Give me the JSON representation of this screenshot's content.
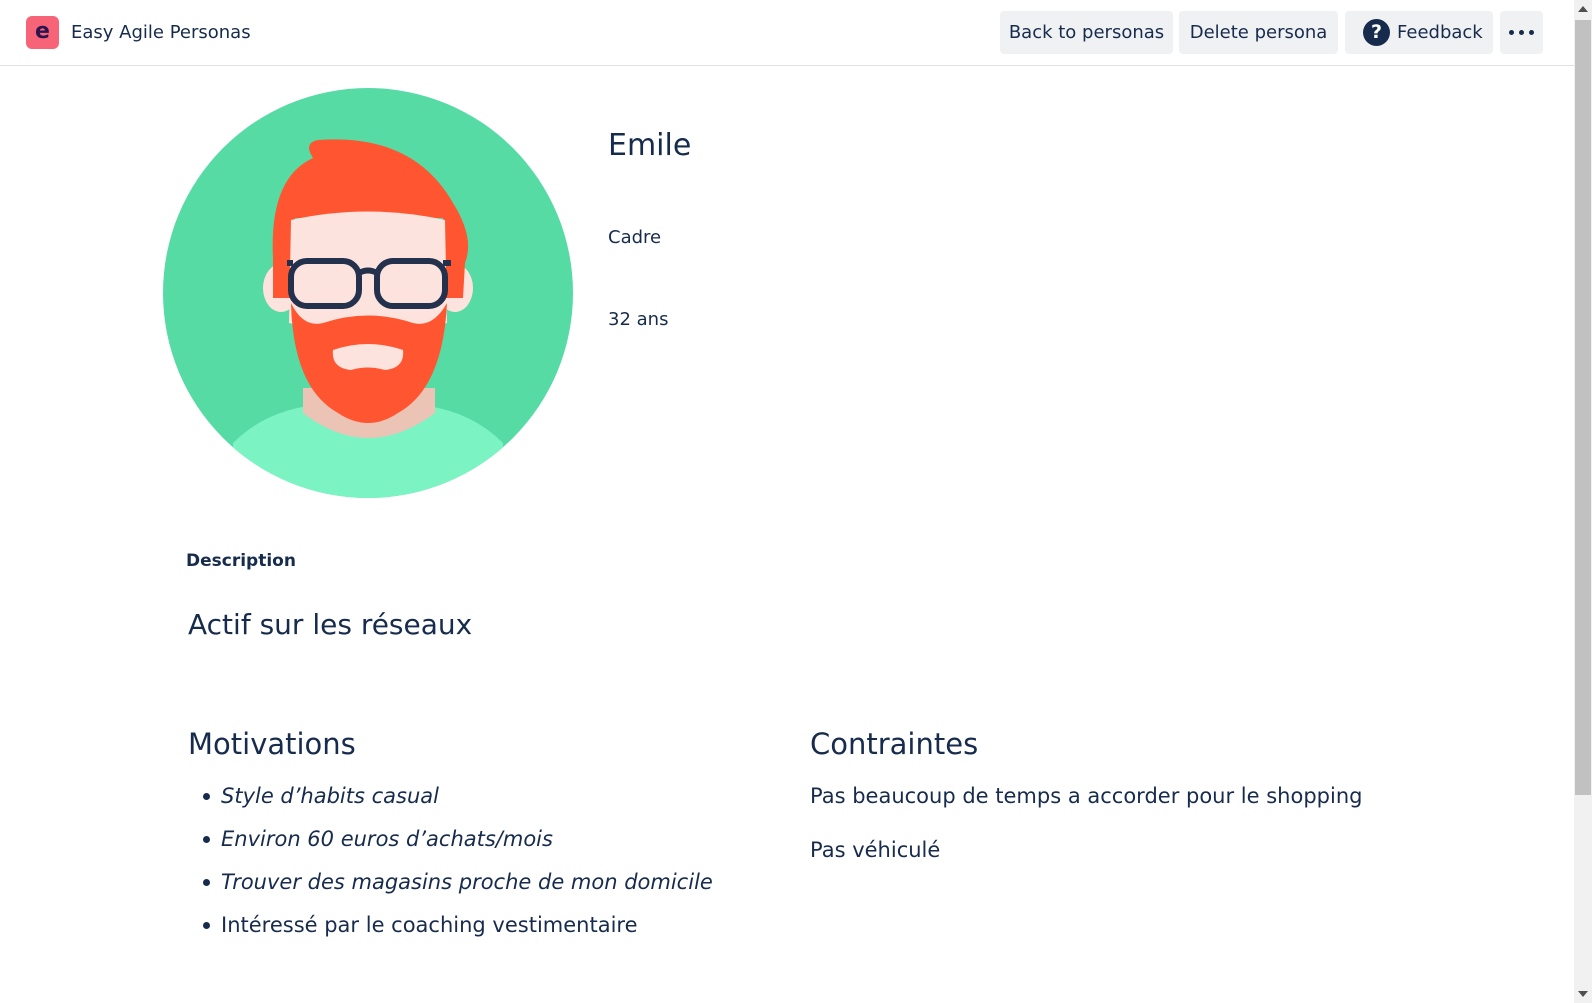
{
  "app": {
    "title": "Easy Agile Personas",
    "logo_letter": "e"
  },
  "toolbar": {
    "back_label": "Back to personas",
    "delete_label": "Delete persona",
    "feedback_label": "Feedback",
    "help_glyph": "?",
    "more_icon": "more-horizontal-icon"
  },
  "persona": {
    "name": "Emile",
    "role": "Cadre",
    "age": "32 ans"
  },
  "description": {
    "label": "Description",
    "text": "Actif sur les réseaux"
  },
  "motivations": {
    "title": "Motivations",
    "items": [
      {
        "text": "Style d’habits casual"
      },
      {
        "text": "Environ 60 euros d’achats/mois"
      },
      {
        "text": "Trouver des magasins proche de mon domicile"
      },
      {
        "text": "Intéressé par le coaching vestimentaire"
      }
    ]
  },
  "constraints": {
    "title": "Contraintes",
    "items": [
      {
        "text": "Pas beaucoup de temps a accorder pour le shopping"
      },
      {
        "text": "Pas véhiculé"
      }
    ]
  },
  "colors": {
    "text": "#172b4d",
    "logo_bg": "#f86477",
    "button_bg": "#f0f1f3",
    "avatar_bg": "#57dba5",
    "avatar_shirt": "#7bf3c2",
    "hair": "#ff5631",
    "skin": "#fde3dd"
  }
}
